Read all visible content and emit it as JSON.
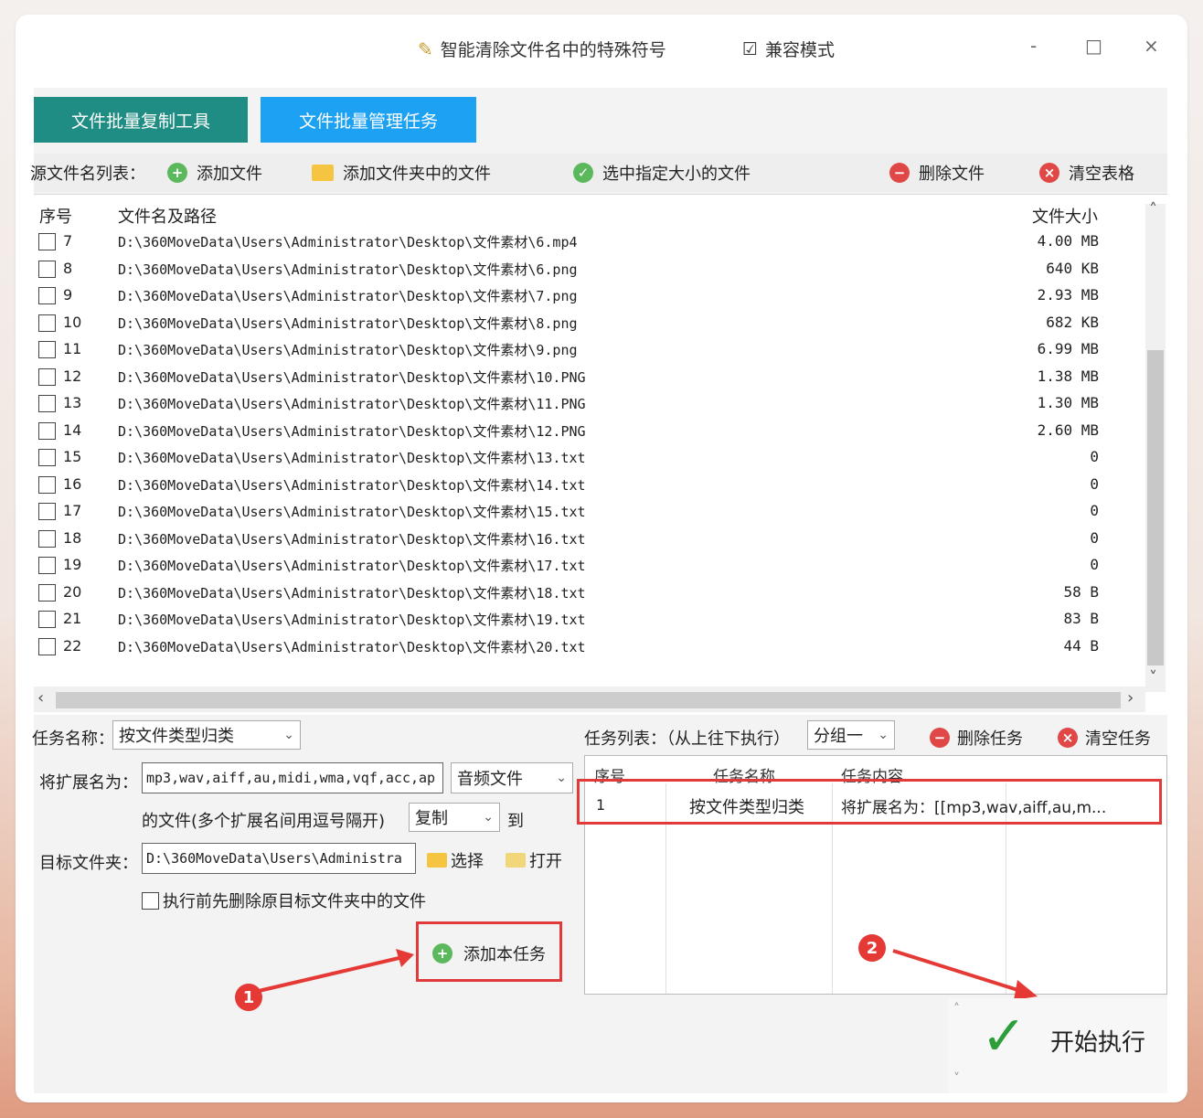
{
  "titlebar": {
    "special_chars_label": "智能清除文件名中的特殊符号",
    "compat_label": "兼容模式",
    "min": "-",
    "max": "□",
    "close": "×"
  },
  "tabs": [
    {
      "label": "文件批量复制工具",
      "color": "#1f8d84"
    },
    {
      "label": "文件批量管理任务",
      "color": "#1da1f2"
    }
  ],
  "toolbar": {
    "list_label": "源文件名列表：",
    "add_file": "添加文件",
    "add_folder": "添加文件夹中的文件",
    "select_size": "选中指定大小的文件",
    "delete_file": "删除文件",
    "clear_table": "清空表格"
  },
  "file_list": {
    "col_index": "序号",
    "col_path": "文件名及路径",
    "col_size": "文件大小",
    "rows": [
      {
        "n": "7",
        "path": "D:\\360MoveData\\Users\\Administrator\\Desktop\\文件素材\\6.mp4",
        "size": "4.00 MB"
      },
      {
        "n": "8",
        "path": "D:\\360MoveData\\Users\\Administrator\\Desktop\\文件素材\\6.png",
        "size": "640 KB"
      },
      {
        "n": "9",
        "path": "D:\\360MoveData\\Users\\Administrator\\Desktop\\文件素材\\7.png",
        "size": "2.93 MB"
      },
      {
        "n": "10",
        "path": "D:\\360MoveData\\Users\\Administrator\\Desktop\\文件素材\\8.png",
        "size": "682 KB"
      },
      {
        "n": "11",
        "path": "D:\\360MoveData\\Users\\Administrator\\Desktop\\文件素材\\9.png",
        "size": "6.99 MB"
      },
      {
        "n": "12",
        "path": "D:\\360MoveData\\Users\\Administrator\\Desktop\\文件素材\\10.PNG",
        "size": "1.38 MB"
      },
      {
        "n": "13",
        "path": "D:\\360MoveData\\Users\\Administrator\\Desktop\\文件素材\\11.PNG",
        "size": "1.30 MB"
      },
      {
        "n": "14",
        "path": "D:\\360MoveData\\Users\\Administrator\\Desktop\\文件素材\\12.PNG",
        "size": "2.60 MB"
      },
      {
        "n": "15",
        "path": "D:\\360MoveData\\Users\\Administrator\\Desktop\\文件素材\\13.txt",
        "size": "0"
      },
      {
        "n": "16",
        "path": "D:\\360MoveData\\Users\\Administrator\\Desktop\\文件素材\\14.txt",
        "size": "0"
      },
      {
        "n": "17",
        "path": "D:\\360MoveData\\Users\\Administrator\\Desktop\\文件素材\\15.txt",
        "size": "0"
      },
      {
        "n": "18",
        "path": "D:\\360MoveData\\Users\\Administrator\\Desktop\\文件素材\\16.txt",
        "size": "0"
      },
      {
        "n": "19",
        "path": "D:\\360MoveData\\Users\\Administrator\\Desktop\\文件素材\\17.txt",
        "size": "0"
      },
      {
        "n": "20",
        "path": "D:\\360MoveData\\Users\\Administrator\\Desktop\\文件素材\\18.txt",
        "size": "58 B"
      },
      {
        "n": "21",
        "path": "D:\\360MoveData\\Users\\Administrator\\Desktop\\文件素材\\19.txt",
        "size": "83 B"
      },
      {
        "n": "22",
        "path": "D:\\360MoveData\\Users\\Administrator\\Desktop\\文件素材\\20.txt",
        "size": "44 B"
      }
    ]
  },
  "task_form": {
    "name_label": "任务名称：",
    "name_value": "按文件类型归类",
    "ext_label": "将扩展名为：",
    "ext_value": "mp3,wav,aiff,au,midi,wma,vqf,acc,ap",
    "category_value": "音频文件",
    "desc_label": "的文件(多个扩展名间用逗号隔开)",
    "action_value": "复制",
    "to_label": "到",
    "target_label": "目标文件夹：",
    "target_value": "D:\\360MoveData\\Users\\Administra",
    "choose_label": "选择",
    "open_label": "打开",
    "delete_first_label": "执行前先删除原目标文件夹中的文件",
    "add_task_label": "添加本任务"
  },
  "task_list": {
    "label": "任务列表：（从上往下执行）",
    "group_value": "分组一",
    "delete_task": "删除任务",
    "clear_task": "清空任务",
    "col_index": "序号",
    "col_name": "任务名称",
    "col_content": "任务内容",
    "rows": [
      {
        "n": "1",
        "name": "按文件类型归类",
        "content": "将扩展名为：[[mp3,wav,aiff,au,m..."
      }
    ]
  },
  "run_label": "开始执行",
  "annotations": {
    "one": "1",
    "two": "2"
  },
  "colors": {
    "highlight": "#e03a3a",
    "tab_active": "#1da1f2",
    "tab_inactive": "#1f8d84"
  }
}
